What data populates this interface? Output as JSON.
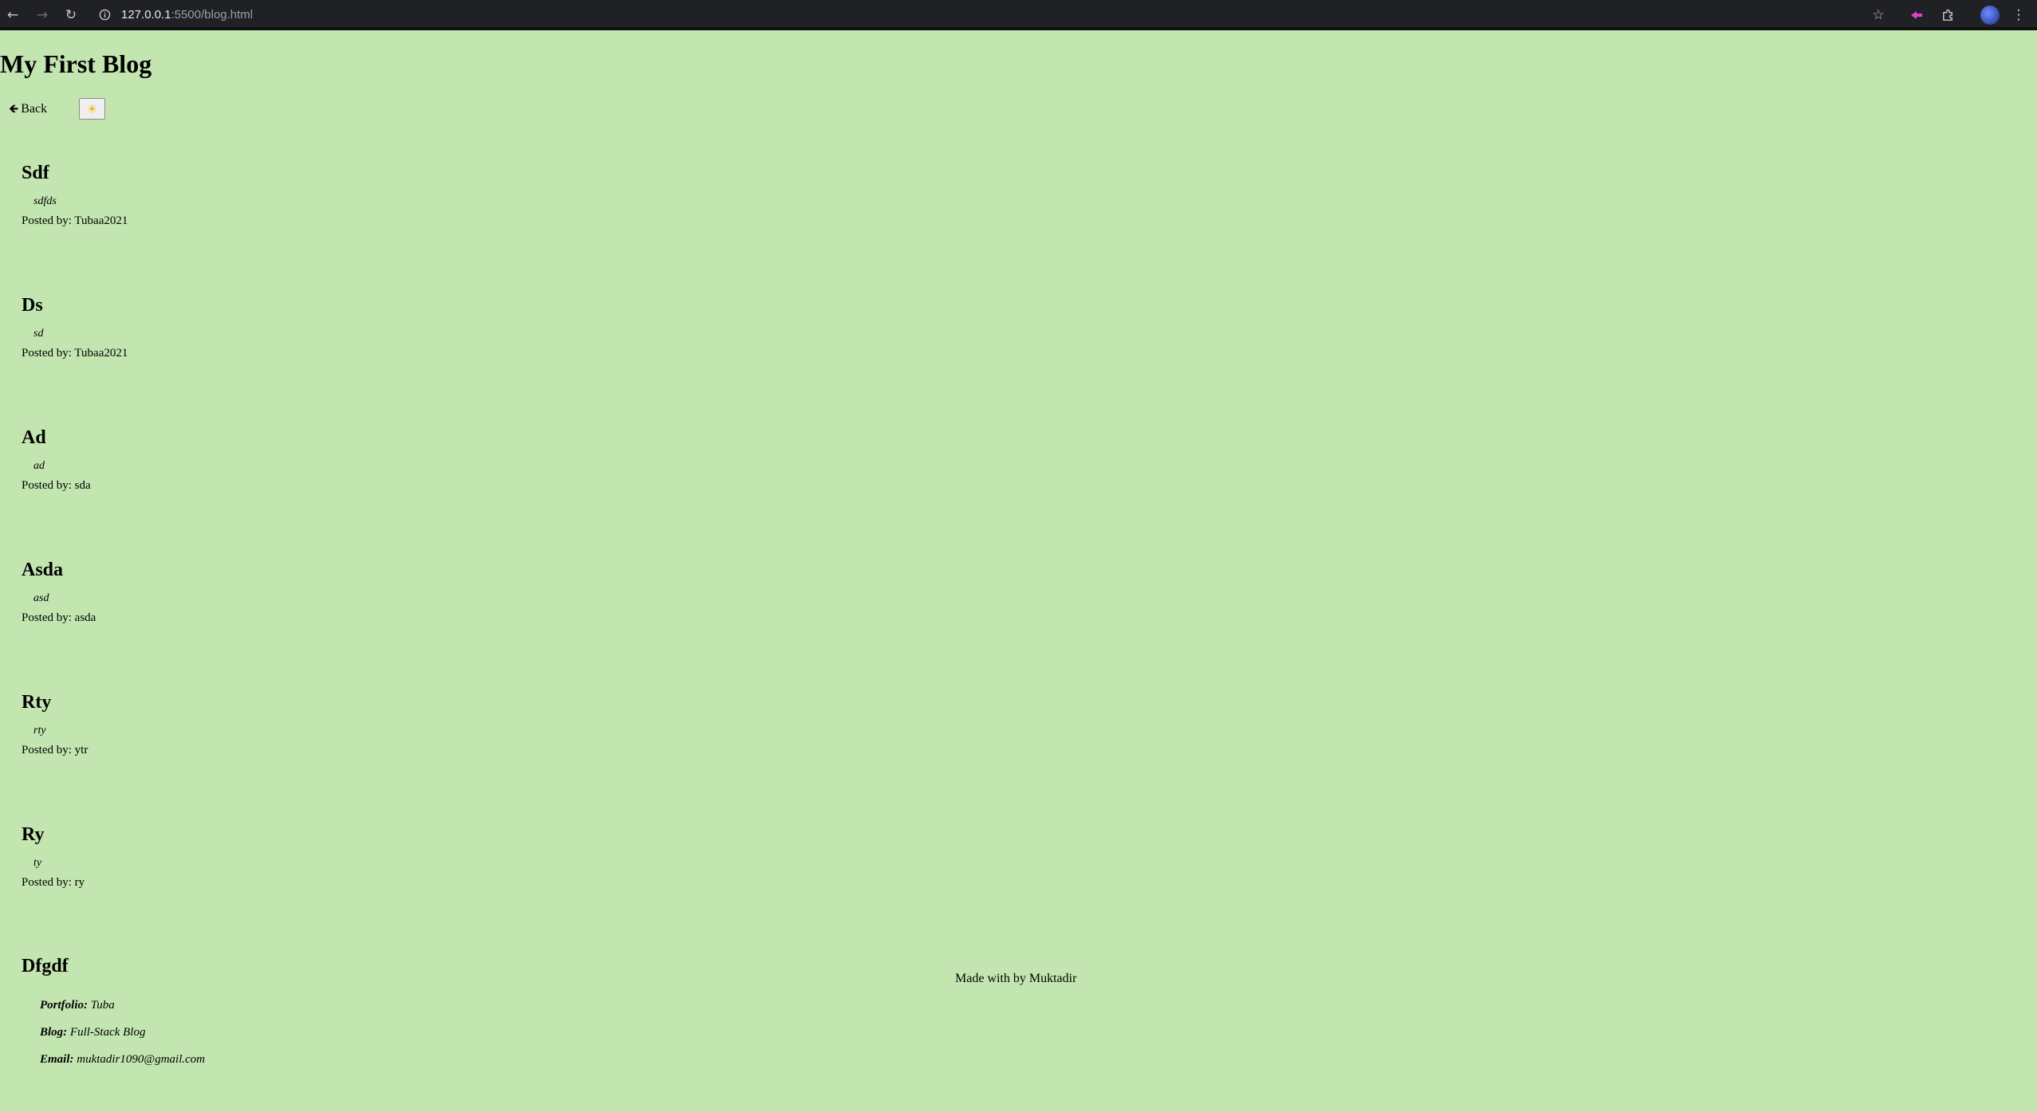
{
  "browser": {
    "url_host": "127.0.0.1",
    "url_path": ":5500/blog.html",
    "icons": [
      "back-arrow-icon",
      "forward-arrow-icon",
      "reload-icon",
      "site-info-icon",
      "bookmark-star-icon",
      "extension-icon",
      "puzzle-icon",
      "profile-avatar",
      "kebab-menu-icon"
    ]
  },
  "page": {
    "title": "My First Blog",
    "back_label": "Back",
    "theme_toggle_icon": "sun-icon"
  },
  "posts": [
    {
      "title": "Sdf",
      "body": "sdfds",
      "author": "Posted by: Tubaa2021"
    },
    {
      "title": "Ds",
      "body": "sd",
      "author": "Posted by: Tubaa2021"
    },
    {
      "title": "Ad",
      "body": "ad",
      "author": "Posted by: sda"
    },
    {
      "title": "Asda",
      "body": "asd",
      "author": "Posted by: asda"
    },
    {
      "title": "Rty",
      "body": "rty",
      "author": "Posted by: ytr"
    },
    {
      "title": "Ry",
      "body": "ty",
      "author": "Posted by: ry"
    },
    {
      "title": "Dfgdf"
    }
  ],
  "footer": {
    "credit": "Made with by Muktadir",
    "portfolio_label": "Portfolio:",
    "portfolio_value": "Tuba",
    "blog_label": "Blog:",
    "blog_value": "Full-Stack Blog",
    "email_label": "Email:",
    "email_value": "muktadir1090@gmail.com"
  },
  "colors": {
    "page_background": "#c3e6b1",
    "chrome_background": "#202124"
  }
}
